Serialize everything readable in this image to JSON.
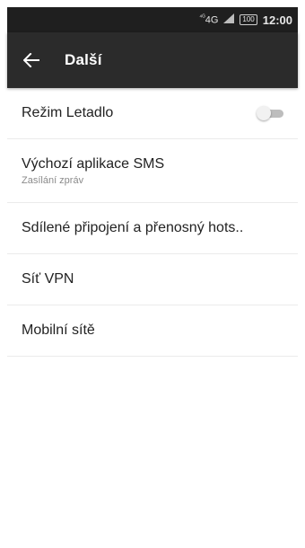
{
  "status_bar": {
    "network": "4G",
    "network_prefix": "⁴ᴳ",
    "battery": "100",
    "time": "12:00"
  },
  "app_bar": {
    "title": "Další",
    "back_icon": "arrow-back-icon"
  },
  "settings": [
    {
      "label": "Režim Letadlo",
      "toggle": "off"
    },
    {
      "label": "Výchozí aplikace SMS",
      "sub": "Zasílání zpráv"
    },
    {
      "label": "Sdílené připojení a přenosný hots.."
    },
    {
      "label": "Síť VPN"
    },
    {
      "label": "Mobilní sítě"
    }
  ],
  "colors": {
    "app_bar": "#2b2b2b",
    "status_bar": "#1f1f1f",
    "divider": "#ebebeb"
  }
}
